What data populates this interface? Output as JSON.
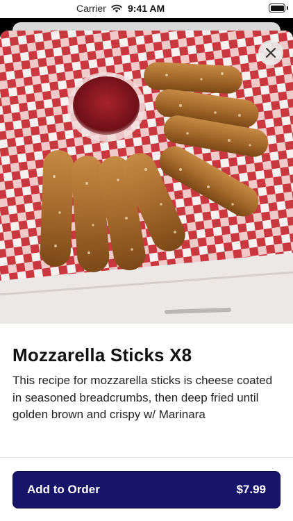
{
  "status_bar": {
    "carrier": "Carrier",
    "time": "9:41 AM",
    "battery_level": 1.0
  },
  "item": {
    "image_alt": "Mozzarella sticks on red checkered paper with marinara cup",
    "name": "Mozzarella Sticks X8",
    "description": "This recipe for mozzarella sticks is cheese coated in seasoned breadcrumbs, then deep fried until golden brown and crispy w/ Marinara"
  },
  "actions": {
    "close_icon": "close-icon",
    "add_to_order_label": "Add to Order",
    "price": "$7.99"
  },
  "colors": {
    "accent": "#17156a",
    "checker_red": "#c9383f",
    "checker_white": "#f6f1ef"
  }
}
